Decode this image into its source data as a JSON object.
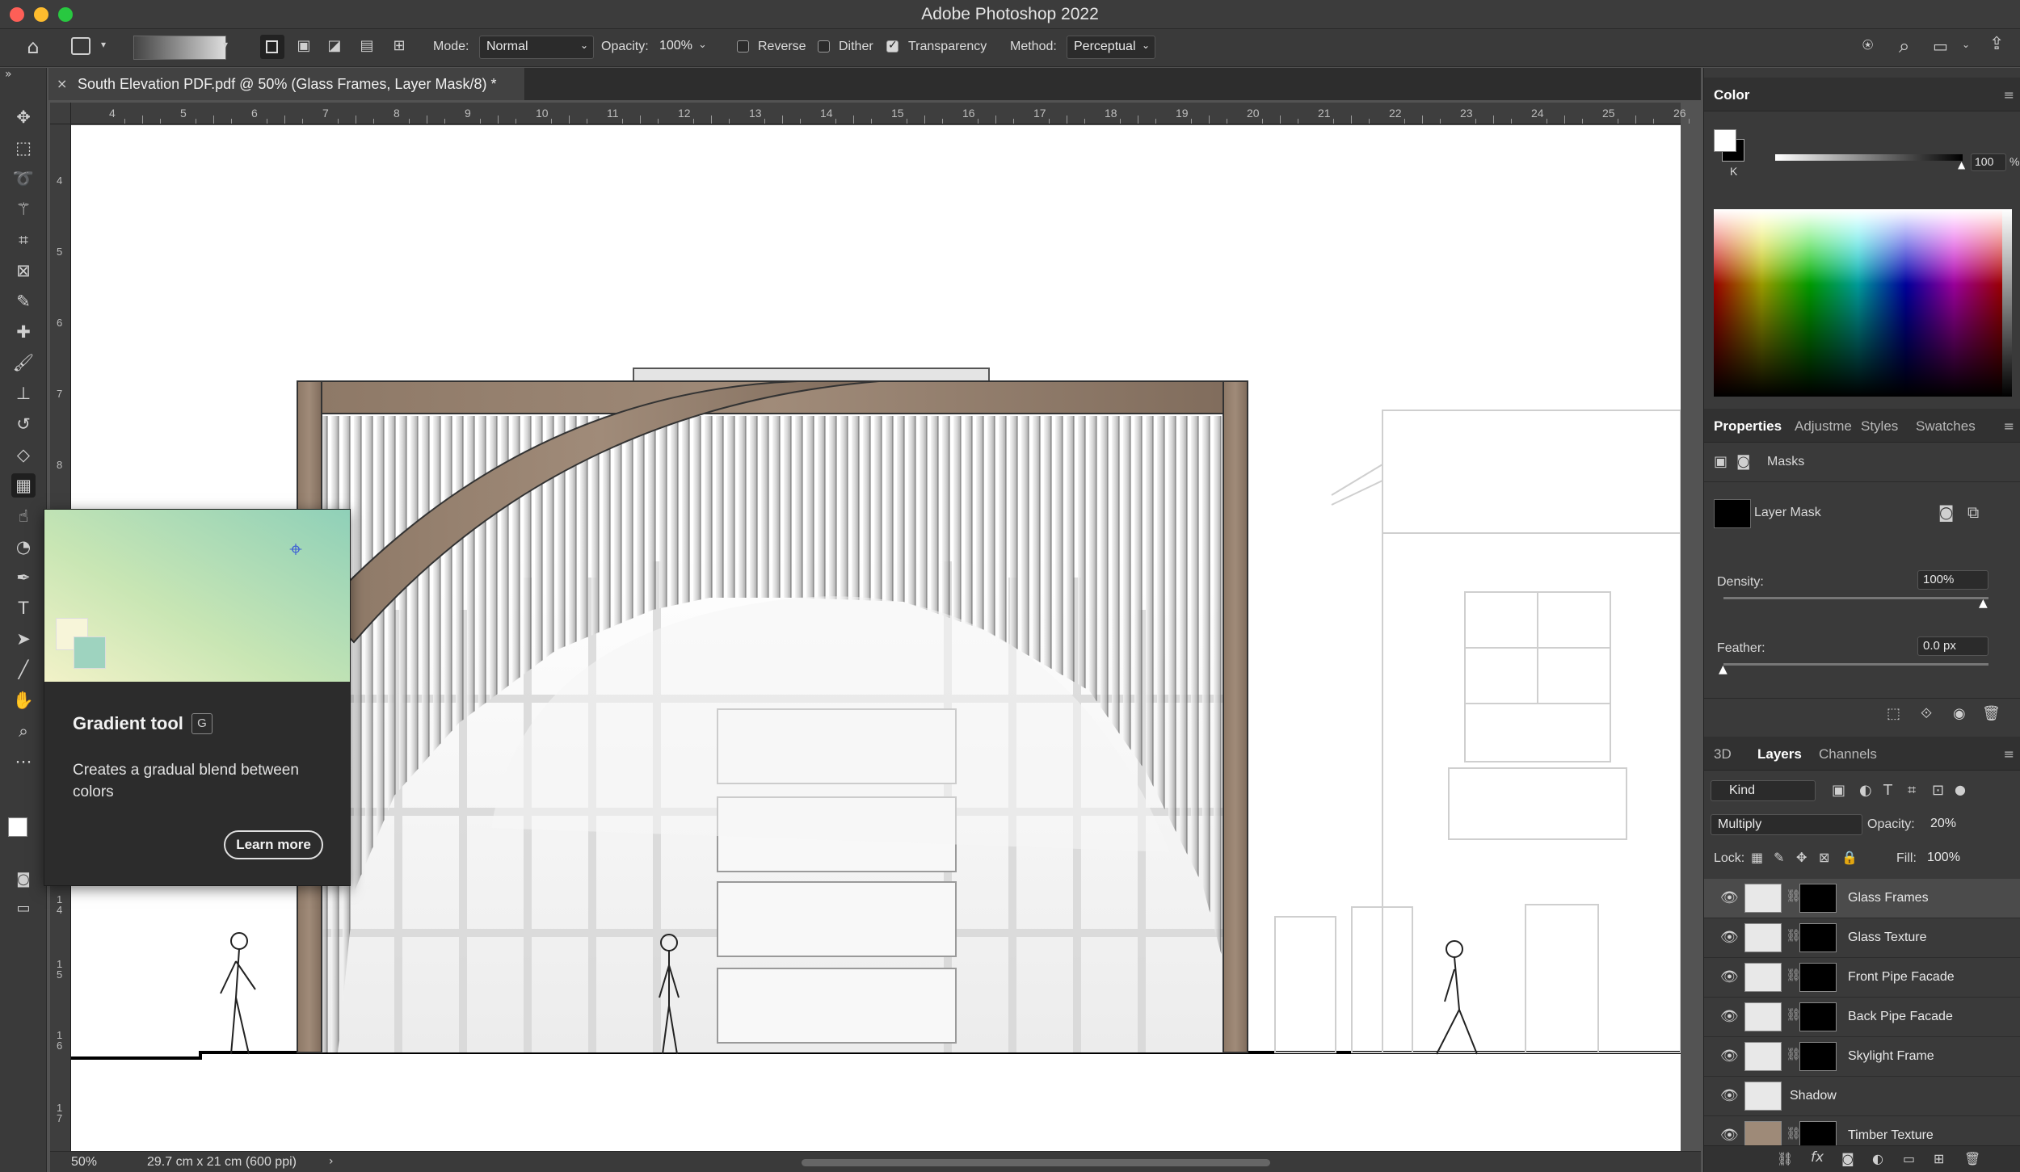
{
  "app": {
    "title": "Adobe Photoshop 2022"
  },
  "options_bar": {
    "mode_label": "Mode:",
    "mode_value": "Normal",
    "opacity_label": "Opacity:",
    "opacity_value": "100%",
    "reverse_label": "Reverse",
    "reverse_checked": false,
    "dither_label": "Dither",
    "dither_checked": false,
    "transparency_label": "Transparency",
    "transparency_checked": true,
    "method_label": "Method:",
    "method_value": "Perceptual"
  },
  "document": {
    "tab_title": "South Elevation PDF.pdf @ 50% (Glass Frames, Layer Mask/8) *",
    "zoom": "50%",
    "doc_info": "29.7 cm x 21 cm (600 ppi)"
  },
  "rulers": {
    "top": [
      "4",
      "5",
      "6",
      "7",
      "8",
      "9",
      "10",
      "11",
      "12",
      "13",
      "14",
      "15",
      "16",
      "17",
      "18",
      "19",
      "20",
      "21",
      "22",
      "23",
      "24",
      "25",
      "26"
    ],
    "left": [
      "4",
      "5",
      "6",
      "7",
      "8",
      "1\n4",
      "1\n5",
      "1\n6",
      "1\n7"
    ]
  },
  "tooltip": {
    "title": "Gradient tool",
    "shortcut": "G",
    "description": "Creates a gradual blend between colors",
    "learn_more": "Learn more"
  },
  "color_panel": {
    "tab": "Color",
    "channel_label": "K",
    "value": "100",
    "unit": "%"
  },
  "properties_panel": {
    "tabs": [
      "Properties",
      "Adjustme",
      "Styles",
      "Swatches"
    ],
    "section": "Masks",
    "mask_label": "Layer Mask",
    "density_label": "Density:",
    "density_value": "100%",
    "feather_label": "Feather:",
    "feather_value": "0.0 px"
  },
  "layers_panel": {
    "tabs": [
      "3D",
      "Layers",
      "Channels"
    ],
    "filter_kind": "Kind",
    "blend_mode": "Multiply",
    "opacity_label": "Opacity:",
    "opacity_value": "20%",
    "lock_label": "Lock:",
    "fill_label": "Fill:",
    "fill_value": "100%",
    "layers": [
      {
        "name": "Glass Frames",
        "selected": true,
        "has_mask": true
      },
      {
        "name": "Glass Texture",
        "selected": false,
        "has_mask": true
      },
      {
        "name": "Front Pipe Facade",
        "selected": false,
        "has_mask": true
      },
      {
        "name": "Back Pipe Facade",
        "selected": false,
        "has_mask": true
      },
      {
        "name": "Skylight Frame",
        "selected": false,
        "has_mask": true
      },
      {
        "name": "Shadow",
        "selected": false,
        "has_mask": false
      },
      {
        "name": "Timber Texture",
        "selected": false,
        "has_mask": true
      }
    ]
  },
  "icons": {
    "home": "home-icon",
    "search": "search-icon",
    "share": "share-icon",
    "move": "move-icon",
    "marquee": "marquee-icon",
    "lasso": "lasso-icon",
    "magic_wand": "magic-wand-icon",
    "crop": "crop-icon",
    "frame": "frame-icon",
    "eyedropper": "eyedropper-icon",
    "healing": "healing-icon",
    "brush": "brush-icon",
    "stamp": "stamp-icon",
    "history_brush": "history-brush-icon",
    "eraser": "eraser-icon",
    "gradient": "gradient-icon",
    "smudge": "smudge-icon",
    "dodge": "dodge-icon",
    "pen": "pen-icon",
    "type": "type-icon",
    "path_select": "path-select-icon",
    "line": "line-icon",
    "hand": "hand-icon",
    "zoom": "zoom-icon",
    "more": "more-icon"
  },
  "colors": {
    "bg_panel": "#3a3a3a",
    "timber": "#8b7563",
    "tooltip_gradient_start": "#f2f2c8",
    "tooltip_gradient_end": "#8fd0b8"
  }
}
